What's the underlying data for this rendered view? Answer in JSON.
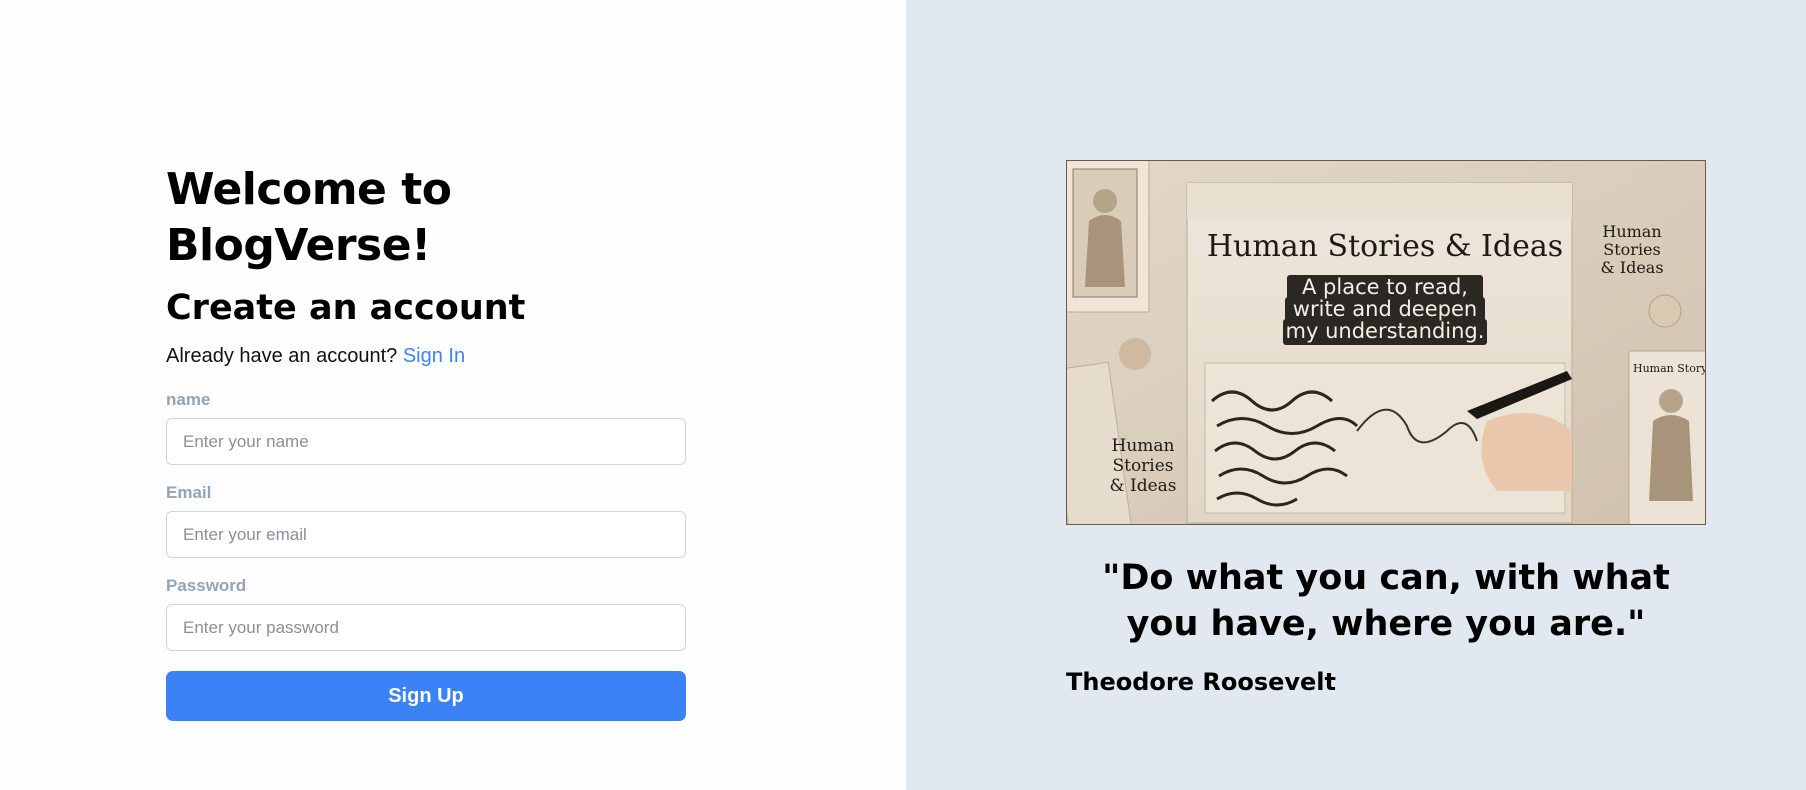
{
  "left": {
    "welcome": "Welcome to BlogVerse!",
    "create": "Create an account",
    "already_text": "Already have an account?",
    "signin_link": "Sign In",
    "fields": [
      {
        "label": "name",
        "placeholder": "Enter your name",
        "type": "text"
      },
      {
        "label": "Email",
        "placeholder": "Enter your email",
        "type": "email"
      },
      {
        "label": "Password",
        "placeholder": "Enter your password",
        "type": "password"
      }
    ],
    "signup_button": "Sign Up"
  },
  "right": {
    "image": {
      "title": "Human Stories & Ideas",
      "tagline_lines": [
        "A place to read,",
        "write and deepen",
        "my understanding."
      ],
      "side_label_top": [
        "Human",
        "Stories",
        "& Ideas"
      ],
      "side_label_left": [
        "Human",
        "Stories",
        "& Ideas"
      ],
      "book_spine": "Human Storys & Ic"
    },
    "quote": "\"Do what you can, with what you have, where you are.\"",
    "author": "Theodore Roosevelt"
  },
  "colors": {
    "accent": "#3b82f6",
    "right_bg": "#e2e8f0",
    "label_gray": "#94a3b8",
    "input_border": "#cbd5e1"
  }
}
